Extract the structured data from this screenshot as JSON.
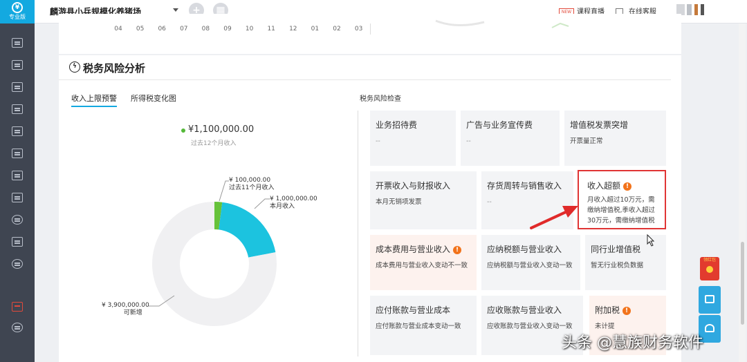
{
  "app": {
    "logo_label": "专业版"
  },
  "topbar": {
    "company": "麟游县小兵规模化养猪场",
    "live_label": "课程直播",
    "live_badge": "NEW",
    "online_label": "在线客服"
  },
  "trend": {
    "months": [
      "04",
      "05",
      "06",
      "07",
      "08",
      "09",
      "10",
      "11",
      "12",
      "01",
      "02",
      "03"
    ]
  },
  "tax_risk": {
    "title": "税务风险分析",
    "tabs": [
      "收入上限预警",
      "所得税变化图"
    ],
    "check_title": "税务风险检查",
    "total_value": "¥1,100,000.00",
    "total_caption": "过去12个月收入",
    "annotations": {
      "past11_value": "¥ 100,000.00",
      "past11_label": "过去11个月收入",
      "current_value": "¥ 1,000,000.00",
      "current_label": "本月收入",
      "remaining_value": "¥ 3,900,000.00",
      "remaining_label": "可新增"
    },
    "tiles": [
      {
        "title": "业务招待费",
        "desc": "--"
      },
      {
        "title": "广告与业务宣传费",
        "desc": "--"
      },
      {
        "title": "增值税发票突增",
        "desc": "开票量正常"
      },
      {
        "title": "开票收入与财报收入",
        "desc": "本月无销项发票"
      },
      {
        "title": "存货周转与销售收入",
        "desc": "--"
      },
      {
        "title": "收入超额",
        "desc1": "月收入超过10万元，需",
        "desc2": "缴纳增值税,季收入超过",
        "desc3": "30万元，需缴纳增值税"
      },
      {
        "title": "成本费用与营业收入",
        "desc": "成本费用与营业收入变动不一致"
      },
      {
        "title": "应纳税额与营业收入",
        "desc": "应纳税额与营业收入变动一致"
      },
      {
        "title": "同行业增值税",
        "desc": "暂无行业税负数据"
      },
      {
        "title": "应付账款与营业成本",
        "desc": "应付账款与营业成本变动一致"
      },
      {
        "title": "应收账款与营业收入",
        "desc": "应收账款与营业收入变动一致"
      },
      {
        "title": "附加税",
        "desc": "未计提"
      }
    ]
  },
  "chart_data": {
    "type": "pie",
    "donut": true,
    "categories": [
      "过去11个月收入",
      "本月收入",
      "可新增"
    ],
    "values": [
      100000,
      1000000,
      3900000
    ],
    "colors": [
      "#66c23a",
      "#1cc3df",
      "#f0f0f2"
    ]
  },
  "float": {
    "red_packet": "领红包"
  },
  "watermark": "头条 @慧族财务软件"
}
